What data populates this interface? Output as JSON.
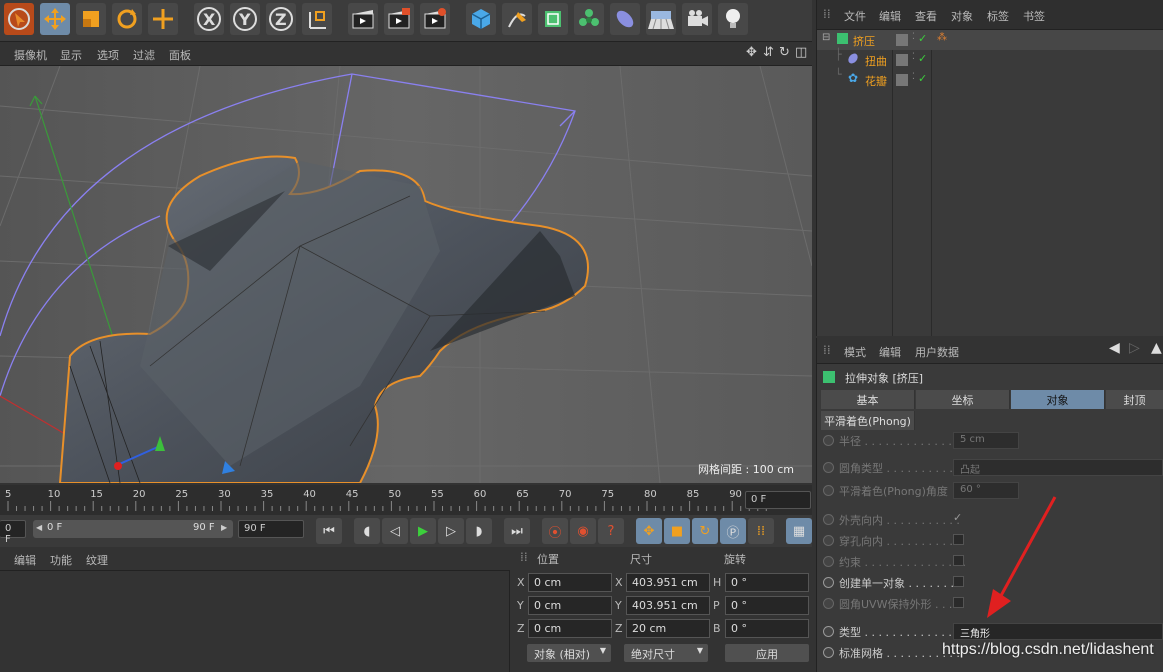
{
  "toolbar": {
    "axis_x": "X",
    "axis_y": "Y",
    "axis_z": "Z"
  },
  "viewport": {
    "menu": [
      "摄像机",
      "显示",
      "选项",
      "过滤",
      "面板"
    ],
    "grid_spacing": "网格间距 : 100 cm"
  },
  "timeline": {
    "ticks": [
      "5",
      "10",
      "15",
      "20",
      "25",
      "30",
      "35",
      "40",
      "45",
      "50",
      "55",
      "60",
      "65",
      "70",
      "75",
      "80",
      "85",
      "90"
    ],
    "current_frame": "0 F",
    "start_field": "0 F",
    "range_start": "0 F",
    "range_end": "90 F",
    "end_field": "90 F"
  },
  "material_panel": {
    "menu": [
      "编辑",
      "功能",
      "纹理"
    ]
  },
  "coord_panel": {
    "headers": {
      "position": "位置",
      "size": "尺寸",
      "rotation": "旋转"
    },
    "rows": [
      {
        "axis": "X",
        "pos": "0 cm",
        "size_axis": "X",
        "size": "403.951 cm",
        "rot_axis": "H",
        "rot": "0 °"
      },
      {
        "axis": "Y",
        "pos": "0 cm",
        "size_axis": "Y",
        "size": "403.951 cm",
        "rot_axis": "P",
        "rot": "0 °"
      },
      {
        "axis": "Z",
        "pos": "0 cm",
        "size_axis": "Z",
        "size": "20 cm",
        "rot_axis": "B",
        "rot": "0 °"
      }
    ],
    "mode_dropdown": "对象 (相对)",
    "size_dropdown": "绝对尺寸",
    "apply_button": "应用"
  },
  "object_manager": {
    "menu": [
      "文件",
      "编辑",
      "查看",
      "对象",
      "标签",
      "书签"
    ],
    "objects": [
      {
        "name": "挤压",
        "level": 0
      },
      {
        "name": "扭曲",
        "level": 1
      },
      {
        "name": "花瓣",
        "level": 1
      }
    ]
  },
  "attribute_manager": {
    "menu": [
      "模式",
      "编辑",
      "用户数据"
    ],
    "object_title": "拉伸对象 [挤压]",
    "tabs": [
      "基本",
      "坐标",
      "对象",
      "封顶"
    ],
    "active_tab": "对象",
    "phong_tab": "平滑着色(Phong)",
    "props": [
      {
        "label": "半径 . . . . . . . . . . . . . . .",
        "value": "5 cm"
      },
      {
        "label": "圆角类型 . . . . . . . . . . . .",
        "value": "凸起"
      },
      {
        "label": "平滑着色(Phong)角度",
        "value": "60 °"
      },
      {
        "label": "外壳向内 . . . . . . . . . . .",
        "check": "✓"
      },
      {
        "label": "穿孔向内 . . . . . . . . . . ."
      },
      {
        "label": "约束 . . . . . . . . . . . . . . ."
      },
      {
        "label": "创建单一对象 . . . . . . ."
      },
      {
        "label": "圆角UVW保持外形 . . . ."
      },
      {
        "label": "类型 . . . . . . . . . . . . . . .",
        "value": "三角形"
      },
      {
        "label": "标准网格 . . . . . . . . . . ."
      }
    ]
  },
  "watermark": "https://blog.csdn.net/lidashent"
}
